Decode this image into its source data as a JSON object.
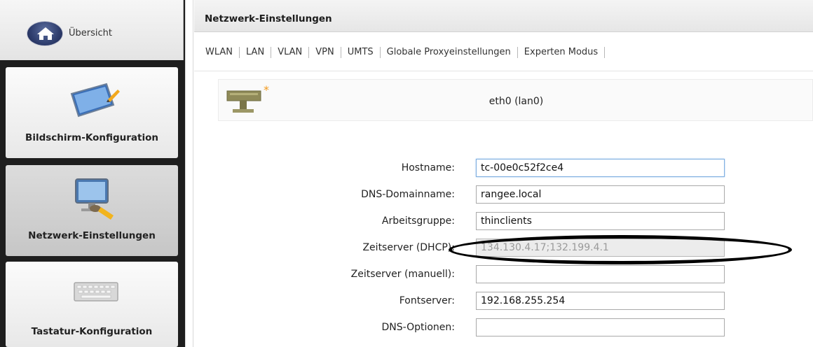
{
  "sidebar": {
    "overview_label": "Übersicht",
    "tiles": [
      {
        "label": "Bildschirm-Konfiguration",
        "icon": "monitor-pencil-icon"
      },
      {
        "label": "Netzwerk-Einstellungen",
        "icon": "network-monitor-icon"
      },
      {
        "label": "Tastatur-Konfiguration",
        "icon": "keyboard-icon"
      }
    ]
  },
  "panel": {
    "title": "Netzwerk-Einstellungen",
    "tabs": [
      "WLAN",
      "LAN",
      "VLAN",
      "VPN",
      "UMTS",
      "Globale Proxyeinstellungen",
      "Experten Modus"
    ]
  },
  "interface": {
    "label": "eth0 (lan0)",
    "icon": "network-adapter-icon",
    "marker": "*"
  },
  "form": {
    "hostname": {
      "label": "Hostname:",
      "value": "tc-00e0c52f2ce4"
    },
    "dns_domain": {
      "label": "DNS-Domainname:",
      "value": "rangee.local"
    },
    "workgroup": {
      "label": "Arbeitsgruppe:",
      "value": "thinclients"
    },
    "timeserver_dhcp": {
      "label": "Zeitserver (DHCP):",
      "value": "134.130.4.17;132.199.4.1"
    },
    "timeserver_manual": {
      "label": "Zeitserver (manuell):",
      "value": ""
    },
    "fontserver": {
      "label": "Fontserver:",
      "value": "192.168.255.254"
    },
    "dns_options": {
      "label": "DNS-Optionen:",
      "value": ""
    }
  },
  "colors": {
    "sidebar_bg": "#1e1e1e",
    "annotation": "#000000",
    "focus_border": "#7eaee0"
  }
}
